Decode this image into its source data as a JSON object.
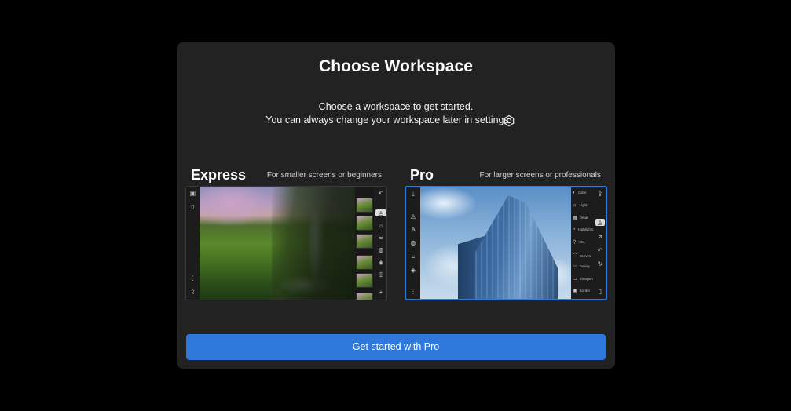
{
  "dialog": {
    "title": "Choose Workspace",
    "subtitle_line1": "Choose a workspace to get started.",
    "subtitle_line2": "You can always change your workspace later in settings",
    "settings_icon": "gear-icon"
  },
  "workspaces": [
    {
      "name": "Express",
      "description": "For smaller screens or beginners",
      "selected": false
    },
    {
      "name": "Pro",
      "description": "For larger screens or professionals",
      "selected": true
    }
  ],
  "pro_panel": {
    "items": [
      "Color",
      "Light",
      "Detail",
      "Highlights",
      "HSL",
      "Curves",
      "Toning",
      "Sharpen",
      "Border"
    ]
  },
  "cta": {
    "label": "Get started with Pro"
  },
  "colors": {
    "accent": "#2f79dc",
    "modal_bg": "#222223",
    "page_bg": "#000000"
  }
}
